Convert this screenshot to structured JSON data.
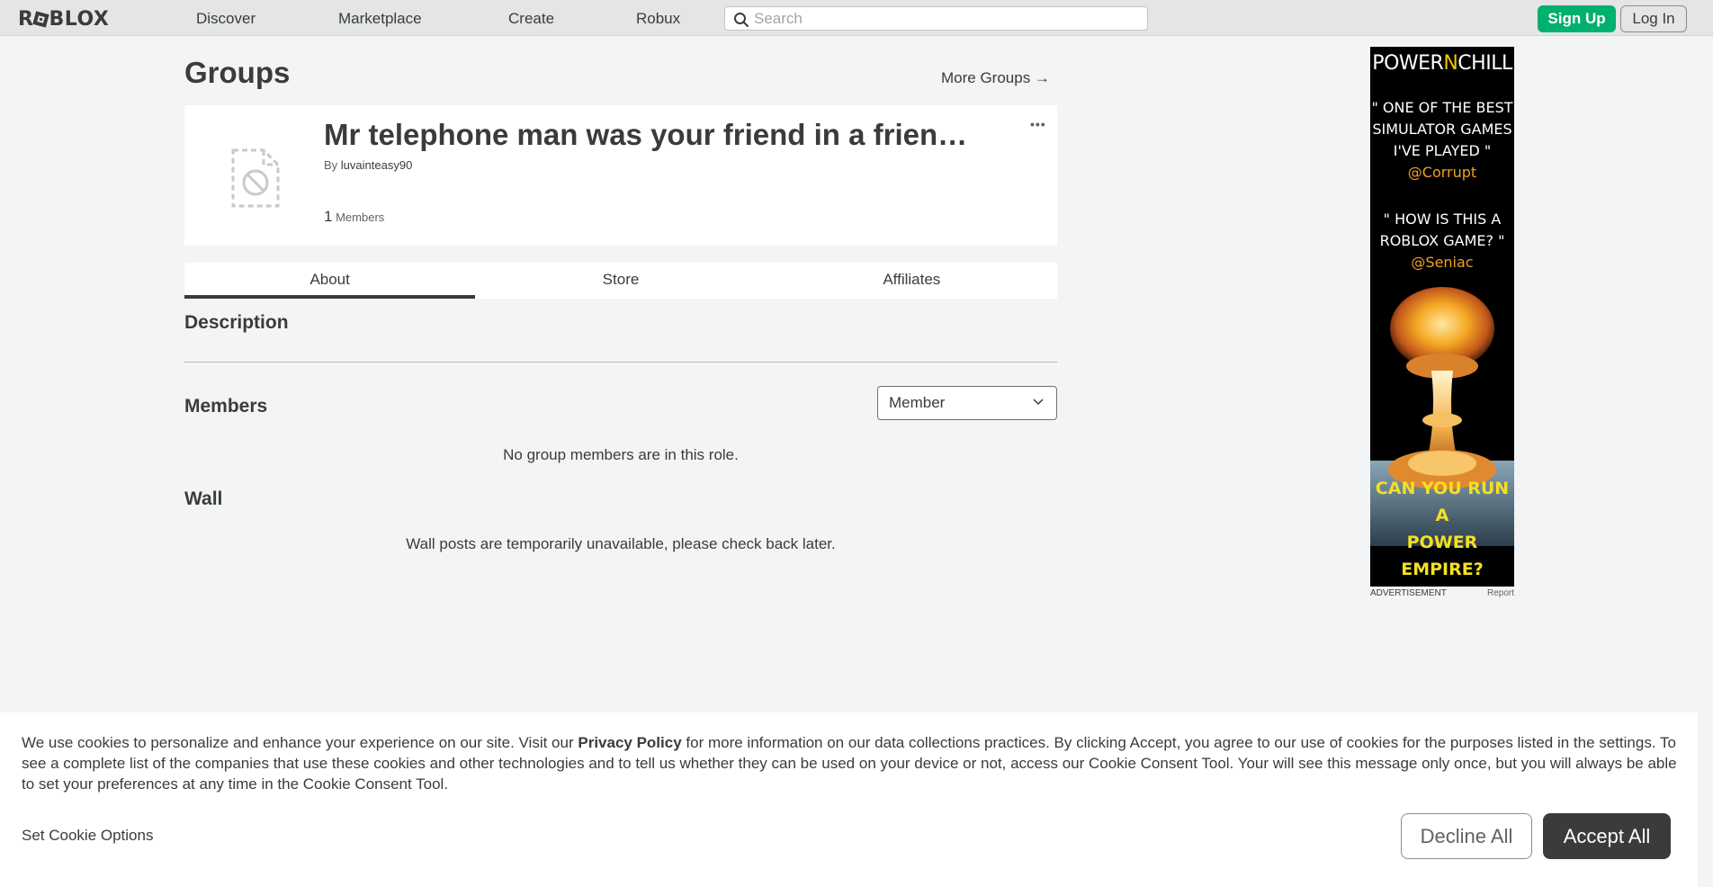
{
  "nav": {
    "logo": "ROBLOX",
    "links": [
      "Discover",
      "Marketplace",
      "Create",
      "Robux"
    ],
    "search_placeholder": "Search",
    "signup_label": "Sign Up",
    "login_label": "Log In"
  },
  "page": {
    "title": "Groups",
    "more_groups": "More Groups →"
  },
  "group": {
    "name": "Mr telephone man was your friend in a frien…",
    "menu": "•••",
    "by_label": "By",
    "owner": "luvainteasy90",
    "member_count": "1",
    "members_label": "Members"
  },
  "tabs": [
    "About",
    "Store",
    "Affiliates"
  ],
  "about": {
    "description_title": "Description",
    "members_title": "Members",
    "role_selected": "Member",
    "members_empty": "No group members are in this role.",
    "wall_title": "Wall",
    "wall_msg": "Wall posts are temporarily unavailable, please check back later."
  },
  "ad": {
    "brand_pre": "POWER",
    "brand_n": "N",
    "brand_post": "CHILL",
    "quote1_lines": [
      "\" ONE OF THE BEST",
      "SIMULATOR GAMES",
      "I'VE PLAYED \""
    ],
    "quote1_handle": "@Corrupt",
    "quote2_lines": [
      "\" HOW IS THIS A",
      "ROBLOX GAME? \""
    ],
    "quote2_handle": "@Seniac",
    "cta_lines": [
      "CAN YOU RUN A",
      "POWER EMPIRE?"
    ],
    "label": "ADVERTISEMENT",
    "report": "Report"
  },
  "cookie": {
    "text_before": "We use cookies to personalize and enhance your experience on our site. Visit our ",
    "privacy_link": "Privacy Policy",
    "text_after": " for more information on our data collections practices. By clicking Accept, you agree to our use of cookies for the purposes listed in the settings. To see a complete list of the companies that use these cookies and other technologies and to tell us whether they can be used on your device or not, access our Cookie Consent Tool. Your will see this message only once, but you will always be able to set your preferences at any time in the Cookie Consent Tool.",
    "set_options": "Set Cookie Options",
    "decline": "Decline All",
    "accept": "Accept All"
  }
}
